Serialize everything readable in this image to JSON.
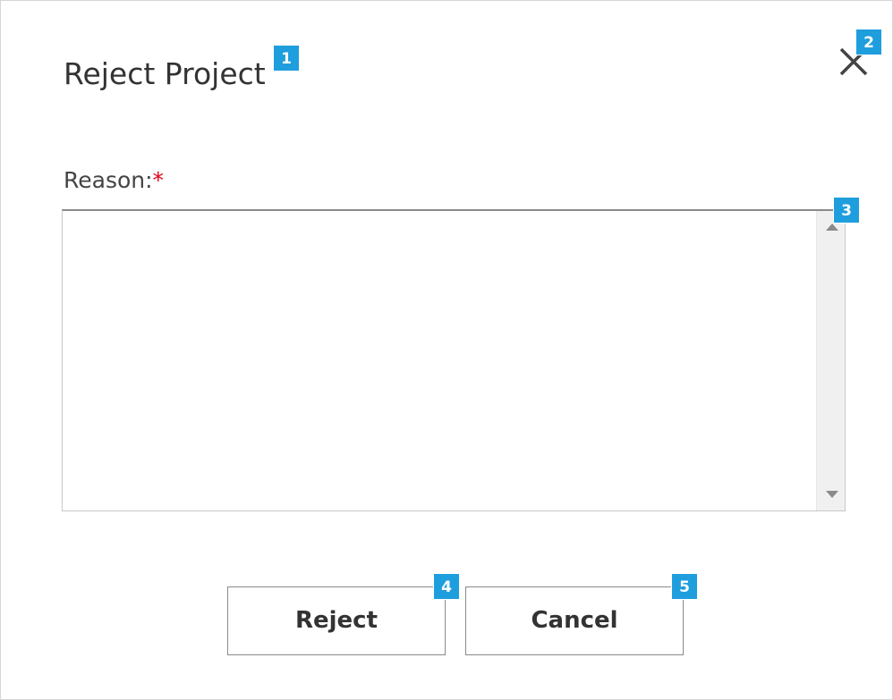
{
  "dialog": {
    "title": "Reject Project",
    "close_icon": "close-icon",
    "reason_label": "Reason:",
    "required_marker": "*",
    "reason_value": "",
    "buttons": {
      "reject_label": "Reject",
      "cancel_label": "Cancel"
    }
  },
  "badges": [
    "1",
    "2",
    "3",
    "4",
    "5"
  ],
  "colors": {
    "badge": "#1f9ede",
    "required": "#e0001b",
    "title_text": "#333333"
  }
}
